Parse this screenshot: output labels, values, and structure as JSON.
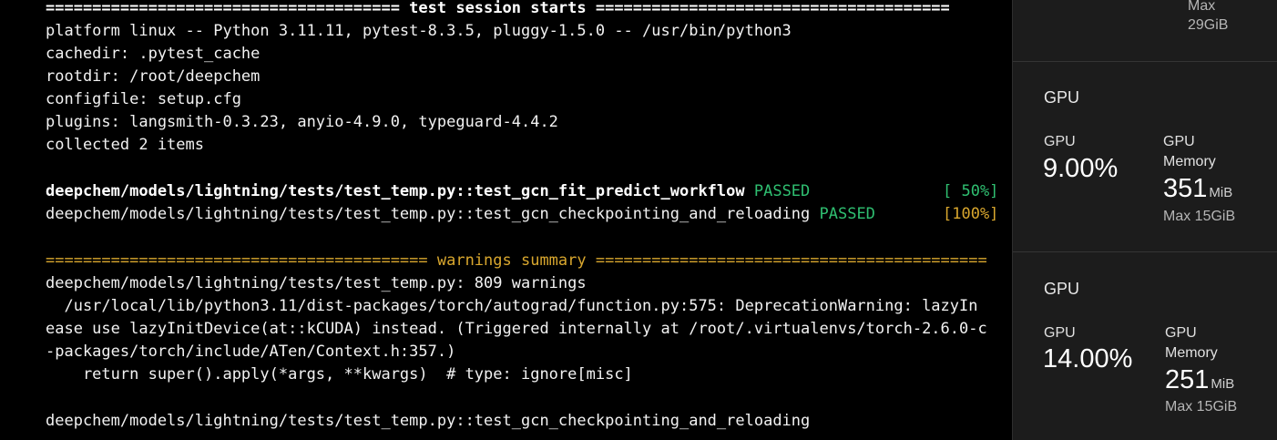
{
  "terminal": {
    "session_header": "====================================== test session starts ======================================",
    "platform": "platform linux -- Python 3.11.11, pytest-8.3.5, pluggy-1.5.0 -- /usr/bin/python3",
    "cachedir": "cachedir: .pytest_cache",
    "rootdir": "rootdir: /root/deepchem",
    "configfile": "configfile: setup.cfg",
    "plugins": "plugins: langsmith-0.3.23, anyio-4.9.0, typeguard-4.4.2",
    "collected": "collected 2 items",
    "test1": {
      "path": "deepchem/models/lightning/tests/test_temp.py::test_gcn_fit_predict_workflow ",
      "status": "PASSED",
      "progress": "[ 50%]"
    },
    "test2": {
      "path": "deepchem/models/lightning/tests/test_temp.py::test_gcn_checkpointing_and_reloading ",
      "status": "PASSED",
      "progress": "[100%]"
    },
    "warnings_header": "========================================= warnings summary ==========================================",
    "warn_file": "deepchem/models/lightning/tests/test_temp.py: 809 warnings",
    "warn_line1": "  /usr/local/lib/python3.11/dist-packages/torch/autograd/function.py:575: DeprecationWarning: lazyIn",
    "warn_line2": "ease use lazyInitDevice(at::kCUDA) instead. (Triggered internally at /root/.virtualenvs/torch-2.6.0-c",
    "warn_line3": "-packages/torch/include/ATen/Context.h:357.)",
    "warn_line4": "    return super().apply(*args, **kwargs)  # type: ignore[misc]",
    "warn_file2": "deepchem/models/lightning/tests/test_temp.py::test_gcn_checkpointing_and_reloading",
    "colors": {
      "passed": "#2fbf71",
      "progress": "#d9a72e"
    }
  },
  "panel": {
    "top": {
      "max_label": "Max",
      "max_value": "29GiB"
    },
    "gpu1": {
      "title": "GPU",
      "util_label": "GPU",
      "util_value": "9.00%",
      "mem_label_1": "GPU",
      "mem_label_2": "Memory",
      "mem_value": "351",
      "mem_unit": "MiB",
      "mem_max": "Max 15GiB"
    },
    "gpu2": {
      "title": "GPU",
      "util_label": "GPU",
      "util_value": "14.00%",
      "mem_label_1": "GPU",
      "mem_label_2": "Memory",
      "mem_value": "251",
      "mem_unit": "MiB",
      "mem_max": "Max 15GiB"
    }
  }
}
